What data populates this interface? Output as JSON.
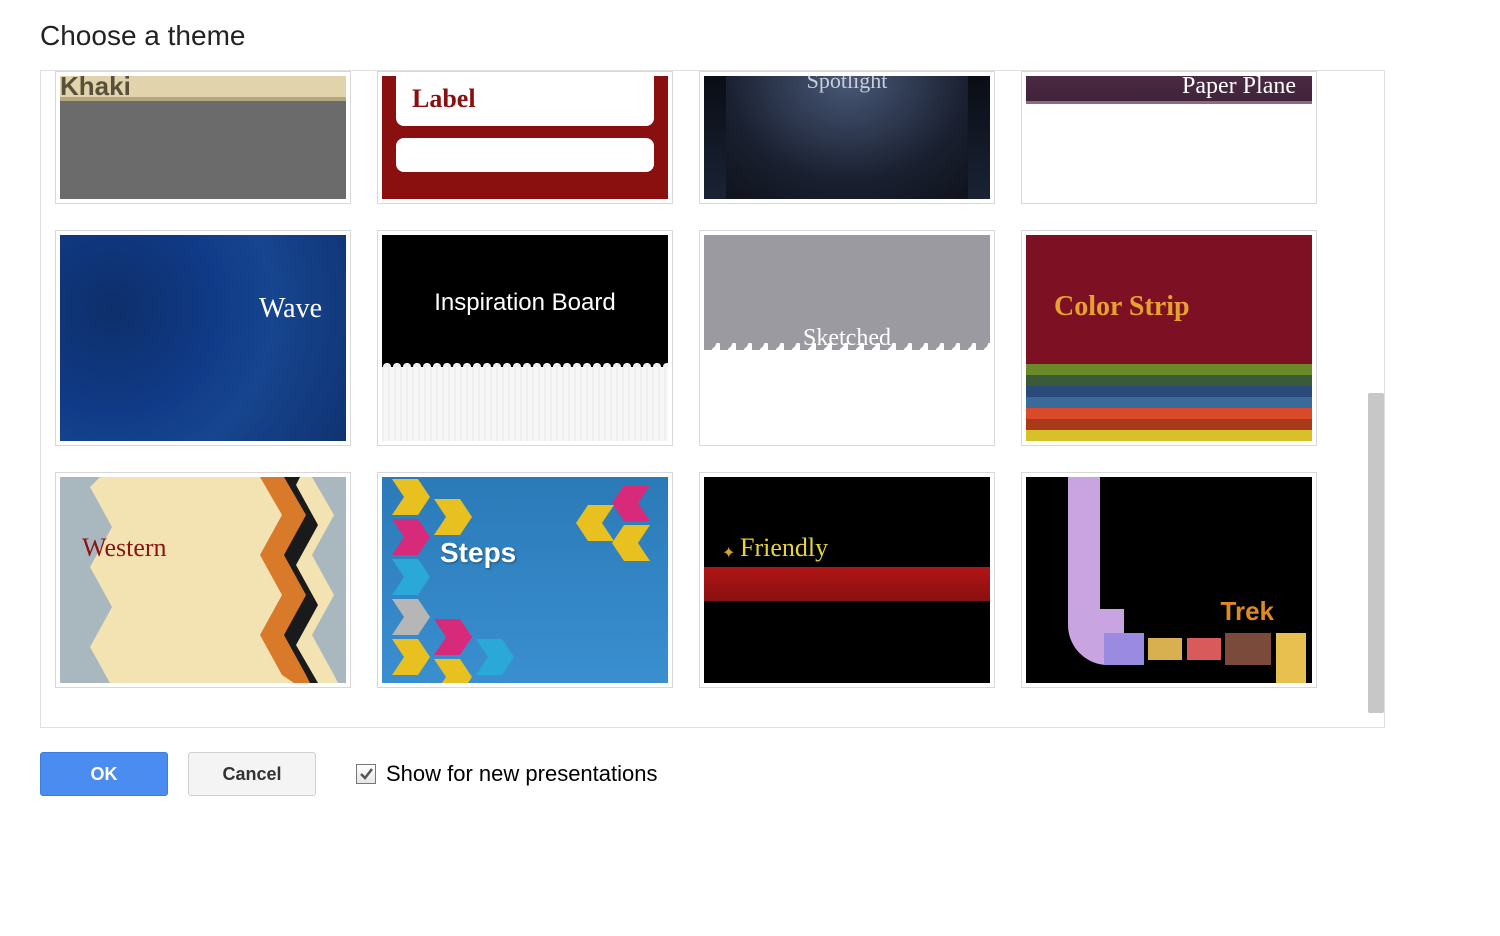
{
  "title": "Choose a theme",
  "themes": {
    "row0": [
      {
        "id": "khaki",
        "name": "Khaki"
      },
      {
        "id": "label",
        "name": "Label"
      },
      {
        "id": "spotlight",
        "name": "Spotlight"
      },
      {
        "id": "paperplane",
        "name": "Paper Plane"
      }
    ],
    "row1": [
      {
        "id": "wave",
        "name": "Wave"
      },
      {
        "id": "inspiration",
        "name": "Inspiration Board"
      },
      {
        "id": "sketched",
        "name": "Sketched"
      },
      {
        "id": "colorstrip",
        "name": "Color Strip"
      }
    ],
    "row2": [
      {
        "id": "western",
        "name": "Western"
      },
      {
        "id": "steps",
        "name": "Steps"
      },
      {
        "id": "friendly",
        "name": "Friendly"
      },
      {
        "id": "trek",
        "name": "Trek"
      }
    ]
  },
  "color_strip_colors": [
    "#6a8a2a",
    "#3a5a3a",
    "#2a4a7a",
    "#3a6a9a",
    "#d84a2a",
    "#a83a1a",
    "#d8c02a"
  ],
  "footer": {
    "ok": "OK",
    "cancel": "Cancel",
    "checkbox_label": "Show for new presentations",
    "checkbox_checked": true
  }
}
